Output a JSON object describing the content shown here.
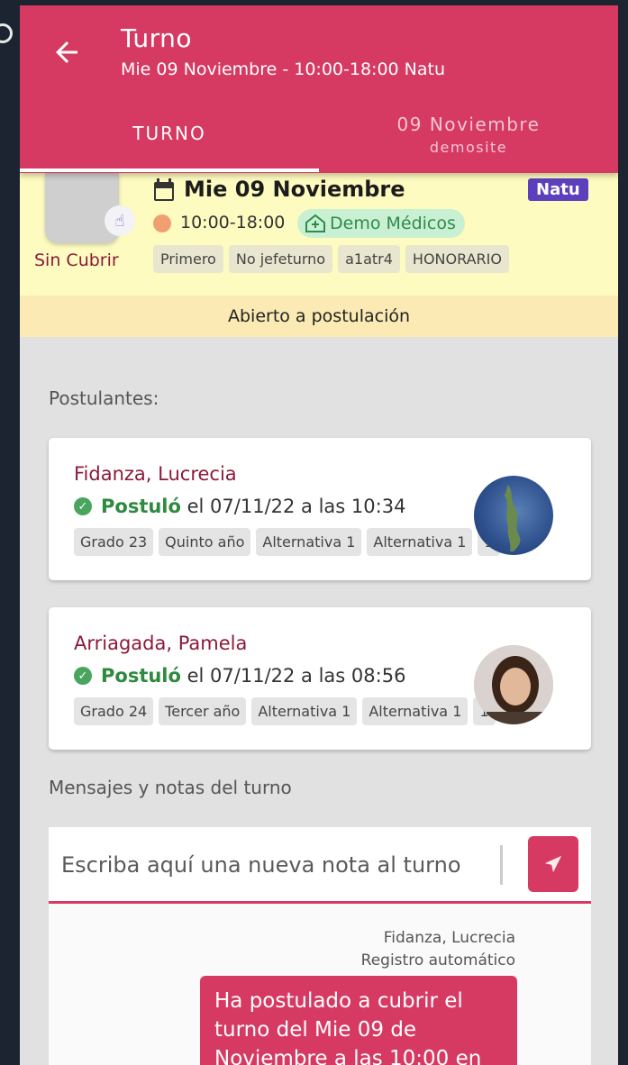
{
  "header": {
    "title": "Turno",
    "subtitle": "Mie 09 Noviembre - 10:00-18:00 Natu",
    "tabs": [
      {
        "label": "TURNO"
      },
      {
        "label": "09 Noviembre",
        "sublabel": "demosite"
      }
    ]
  },
  "shift": {
    "coverage_status": "Sin Cubrir",
    "date": "Mie 09 Noviembre",
    "badge": "Natu",
    "hours": "10:00-18:00",
    "site": "Demo Médicos",
    "tags": [
      "Primero",
      "No jefeturno",
      "a1atr4",
      "HONORARIO"
    ],
    "status": "Abierto a postulación"
  },
  "applicants": {
    "label": "Postulantes:",
    "items": [
      {
        "name": "Fidanza, Lucrecia",
        "action": "Postuló",
        "detail": "el 07/11/22 a las 10:34",
        "tags": [
          "Grado 23",
          "Quinto año",
          "Alternativa 1",
          "Alternativa 1",
          "1"
        ]
      },
      {
        "name": "Arriagada, Pamela",
        "action": "Postuló",
        "detail": "el 07/11/22 a las 08:56",
        "tags": [
          "Grado 24",
          "Tercer año",
          "Alternativa 1",
          "Alternativa 1",
          "1"
        ]
      }
    ]
  },
  "notes": {
    "label": "Mensajes y notas del turno",
    "placeholder": "Escriba aquí una nueva nota al turno",
    "message": {
      "author": "Fidanza, Lucrecia",
      "source": "Registro automático",
      "text": "Ha postulado a cubrir el turno del Mie 09 de Noviembre a las 10:00 en"
    }
  },
  "colors": {
    "brand": "#d63a62",
    "summary_bg": "#fdfbbf",
    "badge": "#5b3fbd",
    "success": "#2e8a3e"
  }
}
